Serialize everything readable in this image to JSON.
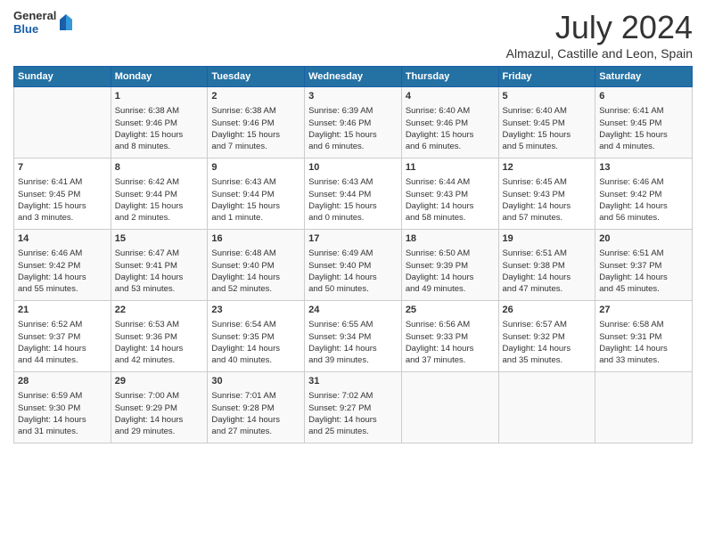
{
  "logo": {
    "general": "General",
    "blue": "Blue"
  },
  "title": "July 2024",
  "subtitle": "Almazul, Castille and Leon, Spain",
  "days_of_week": [
    "Sunday",
    "Monday",
    "Tuesday",
    "Wednesday",
    "Thursday",
    "Friday",
    "Saturday"
  ],
  "weeks": [
    [
      {
        "num": "",
        "info": ""
      },
      {
        "num": "1",
        "info": "Sunrise: 6:38 AM\nSunset: 9:46 PM\nDaylight: 15 hours\nand 8 minutes."
      },
      {
        "num": "2",
        "info": "Sunrise: 6:38 AM\nSunset: 9:46 PM\nDaylight: 15 hours\nand 7 minutes."
      },
      {
        "num": "3",
        "info": "Sunrise: 6:39 AM\nSunset: 9:46 PM\nDaylight: 15 hours\nand 6 minutes."
      },
      {
        "num": "4",
        "info": "Sunrise: 6:40 AM\nSunset: 9:46 PM\nDaylight: 15 hours\nand 6 minutes."
      },
      {
        "num": "5",
        "info": "Sunrise: 6:40 AM\nSunset: 9:45 PM\nDaylight: 15 hours\nand 5 minutes."
      },
      {
        "num": "6",
        "info": "Sunrise: 6:41 AM\nSunset: 9:45 PM\nDaylight: 15 hours\nand 4 minutes."
      }
    ],
    [
      {
        "num": "7",
        "info": "Sunrise: 6:41 AM\nSunset: 9:45 PM\nDaylight: 15 hours\nand 3 minutes."
      },
      {
        "num": "8",
        "info": "Sunrise: 6:42 AM\nSunset: 9:44 PM\nDaylight: 15 hours\nand 2 minutes."
      },
      {
        "num": "9",
        "info": "Sunrise: 6:43 AM\nSunset: 9:44 PM\nDaylight: 15 hours\nand 1 minute."
      },
      {
        "num": "10",
        "info": "Sunrise: 6:43 AM\nSunset: 9:44 PM\nDaylight: 15 hours\nand 0 minutes."
      },
      {
        "num": "11",
        "info": "Sunrise: 6:44 AM\nSunset: 9:43 PM\nDaylight: 14 hours\nand 58 minutes."
      },
      {
        "num": "12",
        "info": "Sunrise: 6:45 AM\nSunset: 9:43 PM\nDaylight: 14 hours\nand 57 minutes."
      },
      {
        "num": "13",
        "info": "Sunrise: 6:46 AM\nSunset: 9:42 PM\nDaylight: 14 hours\nand 56 minutes."
      }
    ],
    [
      {
        "num": "14",
        "info": "Sunrise: 6:46 AM\nSunset: 9:42 PM\nDaylight: 14 hours\nand 55 minutes."
      },
      {
        "num": "15",
        "info": "Sunrise: 6:47 AM\nSunset: 9:41 PM\nDaylight: 14 hours\nand 53 minutes."
      },
      {
        "num": "16",
        "info": "Sunrise: 6:48 AM\nSunset: 9:40 PM\nDaylight: 14 hours\nand 52 minutes."
      },
      {
        "num": "17",
        "info": "Sunrise: 6:49 AM\nSunset: 9:40 PM\nDaylight: 14 hours\nand 50 minutes."
      },
      {
        "num": "18",
        "info": "Sunrise: 6:50 AM\nSunset: 9:39 PM\nDaylight: 14 hours\nand 49 minutes."
      },
      {
        "num": "19",
        "info": "Sunrise: 6:51 AM\nSunset: 9:38 PM\nDaylight: 14 hours\nand 47 minutes."
      },
      {
        "num": "20",
        "info": "Sunrise: 6:51 AM\nSunset: 9:37 PM\nDaylight: 14 hours\nand 45 minutes."
      }
    ],
    [
      {
        "num": "21",
        "info": "Sunrise: 6:52 AM\nSunset: 9:37 PM\nDaylight: 14 hours\nand 44 minutes."
      },
      {
        "num": "22",
        "info": "Sunrise: 6:53 AM\nSunset: 9:36 PM\nDaylight: 14 hours\nand 42 minutes."
      },
      {
        "num": "23",
        "info": "Sunrise: 6:54 AM\nSunset: 9:35 PM\nDaylight: 14 hours\nand 40 minutes."
      },
      {
        "num": "24",
        "info": "Sunrise: 6:55 AM\nSunset: 9:34 PM\nDaylight: 14 hours\nand 39 minutes."
      },
      {
        "num": "25",
        "info": "Sunrise: 6:56 AM\nSunset: 9:33 PM\nDaylight: 14 hours\nand 37 minutes."
      },
      {
        "num": "26",
        "info": "Sunrise: 6:57 AM\nSunset: 9:32 PM\nDaylight: 14 hours\nand 35 minutes."
      },
      {
        "num": "27",
        "info": "Sunrise: 6:58 AM\nSunset: 9:31 PM\nDaylight: 14 hours\nand 33 minutes."
      }
    ],
    [
      {
        "num": "28",
        "info": "Sunrise: 6:59 AM\nSunset: 9:30 PM\nDaylight: 14 hours\nand 31 minutes."
      },
      {
        "num": "29",
        "info": "Sunrise: 7:00 AM\nSunset: 9:29 PM\nDaylight: 14 hours\nand 29 minutes."
      },
      {
        "num": "30",
        "info": "Sunrise: 7:01 AM\nSunset: 9:28 PM\nDaylight: 14 hours\nand 27 minutes."
      },
      {
        "num": "31",
        "info": "Sunrise: 7:02 AM\nSunset: 9:27 PM\nDaylight: 14 hours\nand 25 minutes."
      },
      {
        "num": "",
        "info": ""
      },
      {
        "num": "",
        "info": ""
      },
      {
        "num": "",
        "info": ""
      }
    ]
  ]
}
